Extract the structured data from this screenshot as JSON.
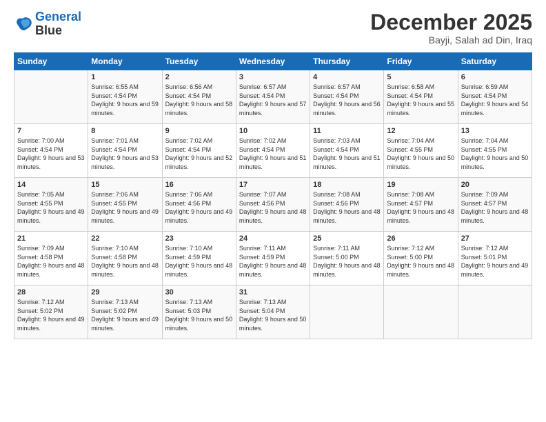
{
  "header": {
    "logo_line1": "General",
    "logo_line2": "Blue",
    "month_title": "December 2025",
    "location": "Bayji, Salah ad Din, Iraq"
  },
  "weekdays": [
    "Sunday",
    "Monday",
    "Tuesday",
    "Wednesday",
    "Thursday",
    "Friday",
    "Saturday"
  ],
  "weeks": [
    [
      {
        "day": "",
        "sunrise": "",
        "sunset": "",
        "daylight": ""
      },
      {
        "day": "1",
        "sunrise": "Sunrise: 6:55 AM",
        "sunset": "Sunset: 4:54 PM",
        "daylight": "Daylight: 9 hours and 59 minutes."
      },
      {
        "day": "2",
        "sunrise": "Sunrise: 6:56 AM",
        "sunset": "Sunset: 4:54 PM",
        "daylight": "Daylight: 9 hours and 58 minutes."
      },
      {
        "day": "3",
        "sunrise": "Sunrise: 6:57 AM",
        "sunset": "Sunset: 4:54 PM",
        "daylight": "Daylight: 9 hours and 57 minutes."
      },
      {
        "day": "4",
        "sunrise": "Sunrise: 6:57 AM",
        "sunset": "Sunset: 4:54 PM",
        "daylight": "Daylight: 9 hours and 56 minutes."
      },
      {
        "day": "5",
        "sunrise": "Sunrise: 6:58 AM",
        "sunset": "Sunset: 4:54 PM",
        "daylight": "Daylight: 9 hours and 55 minutes."
      },
      {
        "day": "6",
        "sunrise": "Sunrise: 6:59 AM",
        "sunset": "Sunset: 4:54 PM",
        "daylight": "Daylight: 9 hours and 54 minutes."
      }
    ],
    [
      {
        "day": "7",
        "sunrise": "Sunrise: 7:00 AM",
        "sunset": "Sunset: 4:54 PM",
        "daylight": "Daylight: 9 hours and 53 minutes."
      },
      {
        "day": "8",
        "sunrise": "Sunrise: 7:01 AM",
        "sunset": "Sunset: 4:54 PM",
        "daylight": "Daylight: 9 hours and 53 minutes."
      },
      {
        "day": "9",
        "sunrise": "Sunrise: 7:02 AM",
        "sunset": "Sunset: 4:54 PM",
        "daylight": "Daylight: 9 hours and 52 minutes."
      },
      {
        "day": "10",
        "sunrise": "Sunrise: 7:02 AM",
        "sunset": "Sunset: 4:54 PM",
        "daylight": "Daylight: 9 hours and 51 minutes."
      },
      {
        "day": "11",
        "sunrise": "Sunrise: 7:03 AM",
        "sunset": "Sunset: 4:54 PM",
        "daylight": "Daylight: 9 hours and 51 minutes."
      },
      {
        "day": "12",
        "sunrise": "Sunrise: 7:04 AM",
        "sunset": "Sunset: 4:55 PM",
        "daylight": "Daylight: 9 hours and 50 minutes."
      },
      {
        "day": "13",
        "sunrise": "Sunrise: 7:04 AM",
        "sunset": "Sunset: 4:55 PM",
        "daylight": "Daylight: 9 hours and 50 minutes."
      }
    ],
    [
      {
        "day": "14",
        "sunrise": "Sunrise: 7:05 AM",
        "sunset": "Sunset: 4:55 PM",
        "daylight": "Daylight: 9 hours and 49 minutes."
      },
      {
        "day": "15",
        "sunrise": "Sunrise: 7:06 AM",
        "sunset": "Sunset: 4:55 PM",
        "daylight": "Daylight: 9 hours and 49 minutes."
      },
      {
        "day": "16",
        "sunrise": "Sunrise: 7:06 AM",
        "sunset": "Sunset: 4:56 PM",
        "daylight": "Daylight: 9 hours and 49 minutes."
      },
      {
        "day": "17",
        "sunrise": "Sunrise: 7:07 AM",
        "sunset": "Sunset: 4:56 PM",
        "daylight": "Daylight: 9 hours and 48 minutes."
      },
      {
        "day": "18",
        "sunrise": "Sunrise: 7:08 AM",
        "sunset": "Sunset: 4:56 PM",
        "daylight": "Daylight: 9 hours and 48 minutes."
      },
      {
        "day": "19",
        "sunrise": "Sunrise: 7:08 AM",
        "sunset": "Sunset: 4:57 PM",
        "daylight": "Daylight: 9 hours and 48 minutes."
      },
      {
        "day": "20",
        "sunrise": "Sunrise: 7:09 AM",
        "sunset": "Sunset: 4:57 PM",
        "daylight": "Daylight: 9 hours and 48 minutes."
      }
    ],
    [
      {
        "day": "21",
        "sunrise": "Sunrise: 7:09 AM",
        "sunset": "Sunset: 4:58 PM",
        "daylight": "Daylight: 9 hours and 48 minutes."
      },
      {
        "day": "22",
        "sunrise": "Sunrise: 7:10 AM",
        "sunset": "Sunset: 4:58 PM",
        "daylight": "Daylight: 9 hours and 48 minutes."
      },
      {
        "day": "23",
        "sunrise": "Sunrise: 7:10 AM",
        "sunset": "Sunset: 4:59 PM",
        "daylight": "Daylight: 9 hours and 48 minutes."
      },
      {
        "day": "24",
        "sunrise": "Sunrise: 7:11 AM",
        "sunset": "Sunset: 4:59 PM",
        "daylight": "Daylight: 9 hours and 48 minutes."
      },
      {
        "day": "25",
        "sunrise": "Sunrise: 7:11 AM",
        "sunset": "Sunset: 5:00 PM",
        "daylight": "Daylight: 9 hours and 48 minutes."
      },
      {
        "day": "26",
        "sunrise": "Sunrise: 7:12 AM",
        "sunset": "Sunset: 5:00 PM",
        "daylight": "Daylight: 9 hours and 48 minutes."
      },
      {
        "day": "27",
        "sunrise": "Sunrise: 7:12 AM",
        "sunset": "Sunset: 5:01 PM",
        "daylight": "Daylight: 9 hours and 49 minutes."
      }
    ],
    [
      {
        "day": "28",
        "sunrise": "Sunrise: 7:12 AM",
        "sunset": "Sunset: 5:02 PM",
        "daylight": "Daylight: 9 hours and 49 minutes."
      },
      {
        "day": "29",
        "sunrise": "Sunrise: 7:13 AM",
        "sunset": "Sunset: 5:02 PM",
        "daylight": "Daylight: 9 hours and 49 minutes."
      },
      {
        "day": "30",
        "sunrise": "Sunrise: 7:13 AM",
        "sunset": "Sunset: 5:03 PM",
        "daylight": "Daylight: 9 hours and 50 minutes."
      },
      {
        "day": "31",
        "sunrise": "Sunrise: 7:13 AM",
        "sunset": "Sunset: 5:04 PM",
        "daylight": "Daylight: 9 hours and 50 minutes."
      },
      {
        "day": "",
        "sunrise": "",
        "sunset": "",
        "daylight": ""
      },
      {
        "day": "",
        "sunrise": "",
        "sunset": "",
        "daylight": ""
      },
      {
        "day": "",
        "sunrise": "",
        "sunset": "",
        "daylight": ""
      }
    ]
  ]
}
